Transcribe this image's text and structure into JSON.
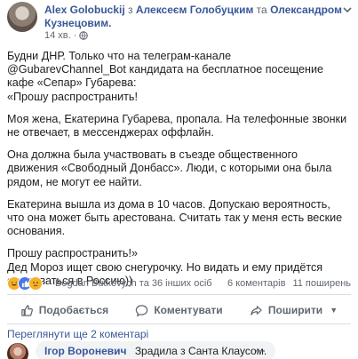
{
  "header": {
    "author": "Alex Golobuckij",
    "with_text": "з",
    "tagged_1": "Алексеєм Голобуцким",
    "and_text": "та",
    "tagged_2": "Олександром Кузнецовим.",
    "time": "14 хв.",
    "separator": "·"
  },
  "post": {
    "paragraphs": [
      "Будни ДНР. Только что на телеграм-канале @GubarevChannel_Bot кандидата на бесплатное посещение кафе «Сепар» Губарева:",
      "«Прошу распространить!",
      "Моя жена, Екатерина Губарева, пропала. На телефонные звонки не отвечает, в мессенджерах оффлайн.",
      "Она должна была участвовать в съезде общественного движения «Свободный Донбасс». Люди, с которыми она была рядом, не могут ее найти.",
      "Екатерина вышла из дома в 10 часов. Допускаю вероятность, что она может быть арестована. Считать так у меня есть веские основания.",
      "Прошу распространить!»",
      "Дед Мороз ищет свою снегурочку. Но видать и ему придётся сматываться в Россию))"
    ]
  },
  "reactions": {
    "reactors": "Bogdan Butkevych та 36 інших осіб",
    "comments_count": "6 коментарів",
    "shares_count": "11 поширень",
    "icons": [
      "haha-icon",
      "like-icon",
      "sad-icon"
    ],
    "colors": {
      "haha": "#f7b125",
      "like": "#4a76e8"
    }
  },
  "actions": {
    "like": "Подобається",
    "comment": "Коментувати",
    "share": "Поширити"
  },
  "comments": {
    "previous": "Переглянути ще 2 коментарі",
    "items": [
      {
        "author": "Ігор Вороневич",
        "text": "Зрадила з Санта Клаусом."
      }
    ]
  },
  "colors": {
    "link": "#385898",
    "text": "#1c1e21",
    "muted": "#616770",
    "divider": "#dadde1"
  }
}
